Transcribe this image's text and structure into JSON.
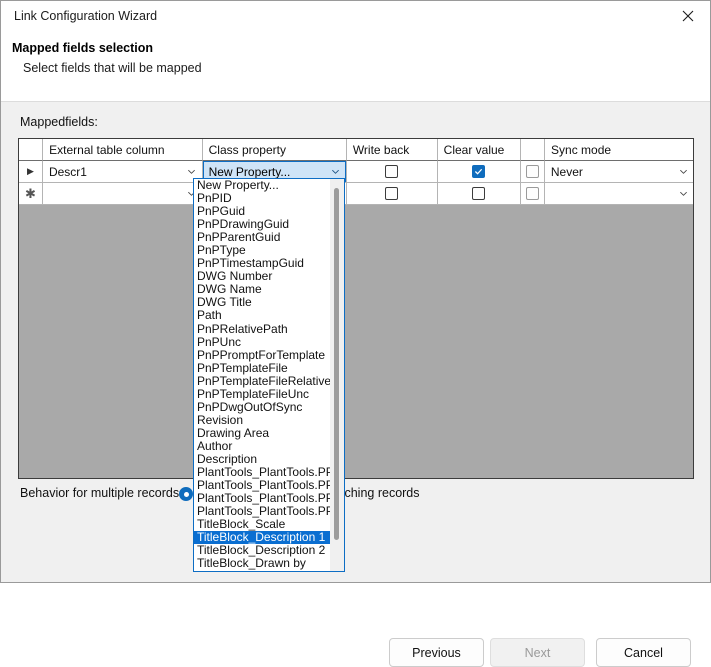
{
  "window": {
    "title": "Link Configuration Wizard",
    "close_icon": "close-icon"
  },
  "header": {
    "title": "Mapped fields selection",
    "subtitle": "Select fields that will be mapped"
  },
  "main": {
    "mapped_fields_label": "Mappedfields:",
    "grid": {
      "columns": [
        "",
        "External table column",
        "Class property",
        "Write back",
        "Clear value",
        "",
        "Sync mode"
      ],
      "rows": [
        {
          "indicator": "▶",
          "external_table_column": "Descr1",
          "class_property": "New Property...",
          "write_back_checked": false,
          "clear_value_checked": true,
          "extra_checked": false,
          "sync_mode": "Never"
        },
        {
          "indicator": "✱",
          "external_table_column": "",
          "class_property": "",
          "write_back_checked": false,
          "clear_value_checked": false,
          "extra_checked": false,
          "sync_mode": ""
        }
      ]
    },
    "behavior": {
      "label": "Behavior for multiple records :",
      "option_text": "tching records",
      "radio_selected": true
    }
  },
  "dropdown": {
    "selected": "TitleBlock_Description 1",
    "items": [
      "New Property...",
      "PnPID",
      "PnPGuid",
      "PnPDrawingGuid",
      "PnPParentGuid",
      "PnPType",
      "PnPTimestampGuid",
      "DWG Number",
      "DWG Name",
      "DWG Title",
      "Path",
      "PnPRelativePath",
      "PnPUnc",
      "PnPPromptForTemplate",
      "PnPTemplateFile",
      "PnPTemplateFileRelative",
      "PnPTemplateFileUnc",
      "PnPDwgOutOfSync",
      "Revision",
      "Drawing Area",
      "Author",
      "Description",
      "PlantTools_PlantTools.PPM",
      "PlantTools_PlantTools.PPM",
      "PlantTools_PlantTools.PPM",
      "PlantTools_PlantTools.PPM",
      "TitleBlock_Scale",
      "TitleBlock_Description 1",
      "TitleBlock_Description 2",
      "TitleBlock_Drawn by"
    ]
  },
  "footer": {
    "previous_label": "Previous",
    "next_label": "Next",
    "cancel_label": "Cancel",
    "next_disabled": true
  },
  "colors": {
    "accent": "#0f6cbd",
    "selection": "#0a6ed1",
    "grid_background": "#a9a9a9",
    "dialog_background": "#f0f0f0"
  }
}
